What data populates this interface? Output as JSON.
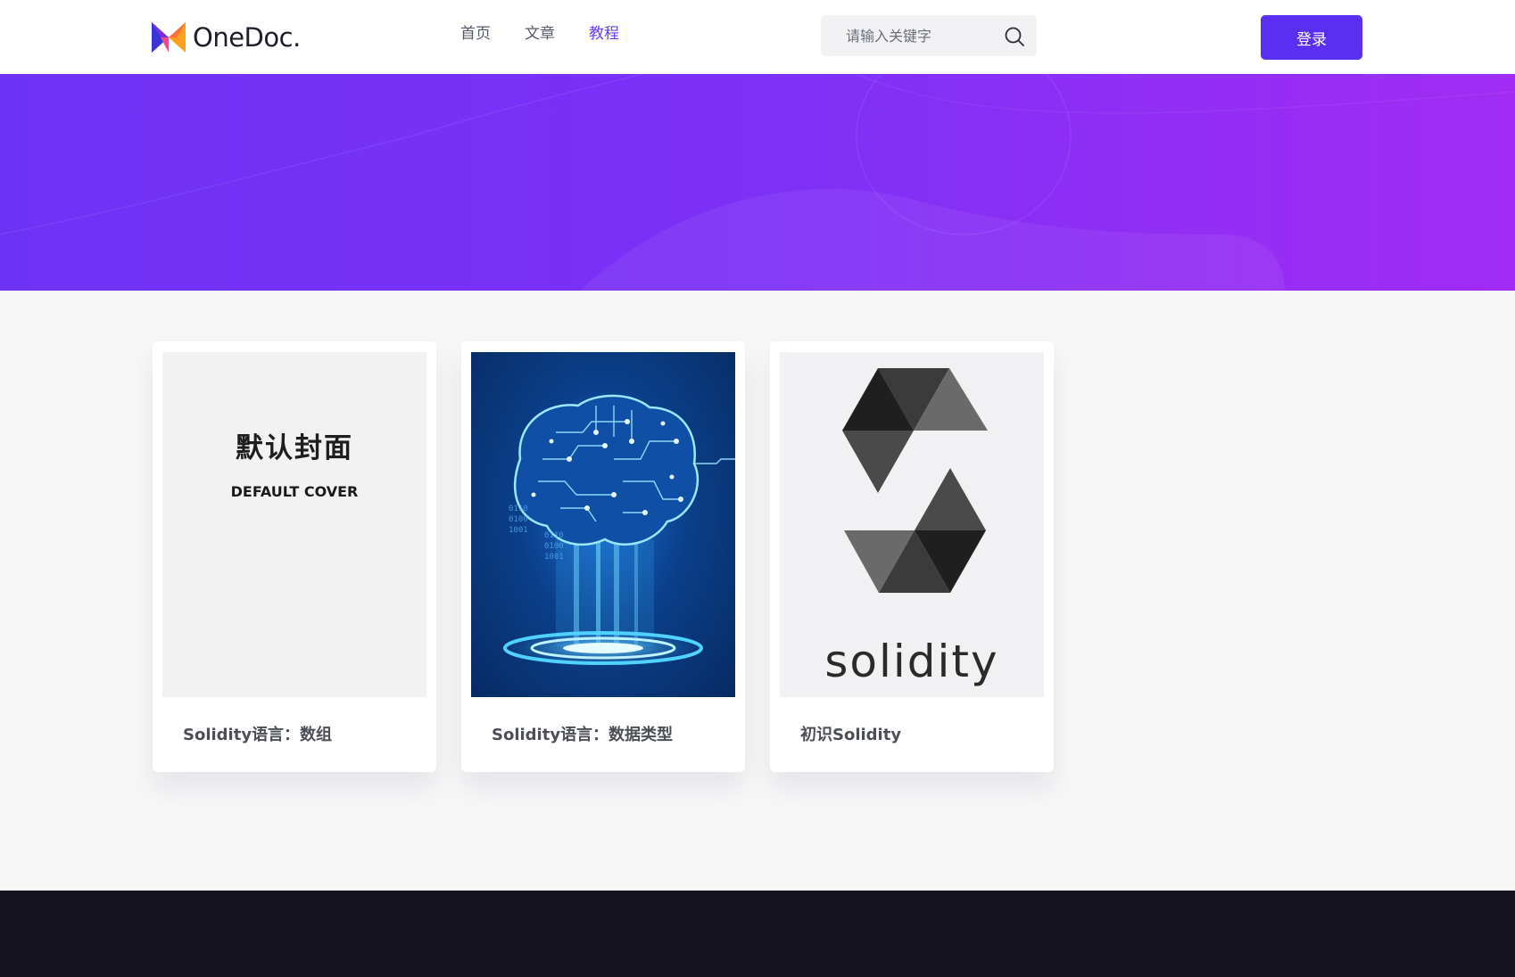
{
  "header": {
    "logo_text": "OneDoc.",
    "nav": [
      {
        "label": "首页",
        "active": false
      },
      {
        "label": "文章",
        "active": false
      },
      {
        "label": "教程",
        "active": true
      }
    ],
    "search": {
      "placeholder": "请输入关键字"
    },
    "login_label": "登录"
  },
  "colors": {
    "accent": "#5b2ff2",
    "active_nav": "#6a3df5",
    "hero_gradient": [
      "#6e32f6",
      "#a22cf3"
    ],
    "footer": "#14131f"
  },
  "cards": [
    {
      "title": "Solidity语言：数组",
      "cover": {
        "type": "default",
        "title_cn": "默认封面",
        "title_en": "DEFAULT COVER"
      }
    },
    {
      "title": "Solidity语言：数据类型",
      "cover": {
        "type": "brain-circuit-illustration",
        "binary_lines": [
          "0110",
          "0100",
          "1001"
        ]
      }
    },
    {
      "title": "初识Solidity",
      "cover": {
        "type": "solidity-logo",
        "word": "solidity"
      }
    }
  ]
}
